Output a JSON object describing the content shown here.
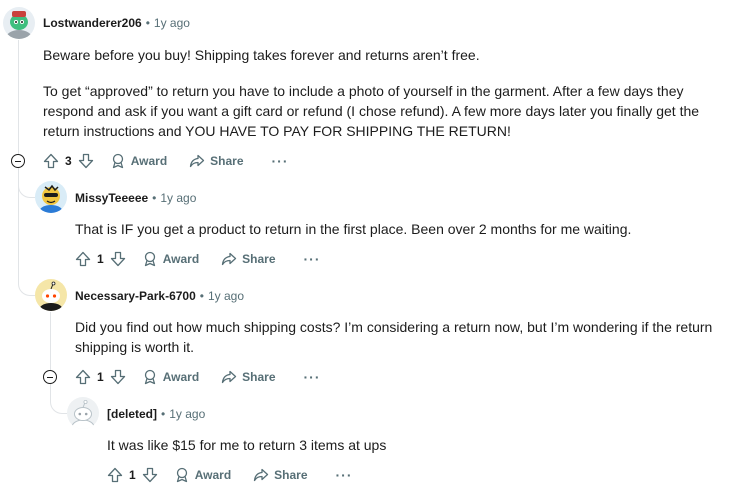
{
  "comments": [
    {
      "author": "Lostwanderer206",
      "separator": "•",
      "time": "1y ago",
      "paragraphs": [
        "Beware before you buy! Shipping takes forever and returns aren’t free.",
        "To get “approved” to return you have to include a photo of yourself in the garment. After a few days they respond and ask if you want a gift card or refund (I chose refund). A few more days later you finally get the return instructions and YOU HAVE TO PAY FOR SHIPPING THE RETURN!"
      ],
      "votes": "3",
      "award_label": "Award",
      "share_label": "Share",
      "more_label": "···"
    },
    {
      "author": "MissyTeeeee",
      "separator": "•",
      "time": "1y ago",
      "paragraphs": [
        "That is IF you get a product to return in the first place. Been over 2 months for me waiting."
      ],
      "votes": "1",
      "award_label": "Award",
      "share_label": "Share",
      "more_label": "···"
    },
    {
      "author": "Necessary-Park-6700",
      "separator": "•",
      "time": "1y ago",
      "paragraphs": [
        "Did you find out how much shipping costs? I’m considering a return now, but I’m wondering if the return shipping is worth it."
      ],
      "votes": "1",
      "award_label": "Award",
      "share_label": "Share",
      "more_label": "···"
    },
    {
      "author": "[deleted]",
      "separator": "•",
      "time": "1y ago",
      "paragraphs": [
        "It was like $15 for me to return 3 items at ups"
      ],
      "votes": "1",
      "award_label": "Award",
      "share_label": "Share",
      "more_label": "···"
    }
  ]
}
